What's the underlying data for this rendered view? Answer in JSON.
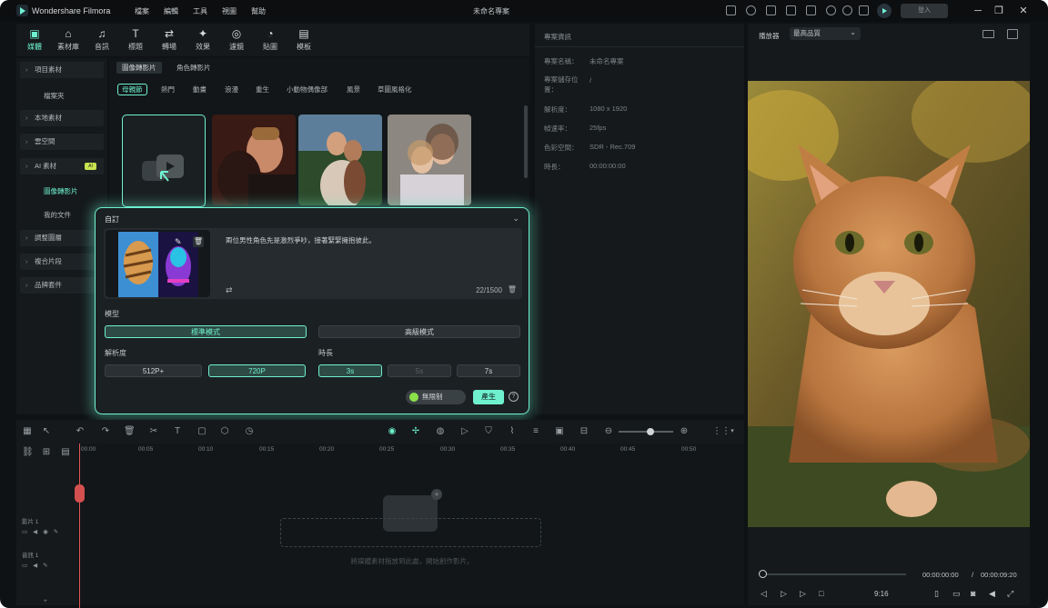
{
  "app": {
    "name": "Wondershare Filmora",
    "doc_title": "未命名專案",
    "signin_label": "登入"
  },
  "menu": [
    "檔案",
    "編輯",
    "工具",
    "視圖",
    "幫助"
  ],
  "toolbar": [
    "媒體",
    "素材庫",
    "音訊",
    "標題",
    "轉場",
    "效果",
    "濾鏡",
    "貼圖",
    "模板"
  ],
  "sidebar": {
    "items": [
      "項目素材",
      "本地素材",
      "雲空間",
      "AI 素材",
      "調整圖層",
      "複合片段",
      "品牌套件"
    ],
    "sub": [
      "檔案夾",
      "圖像轉影片",
      "我的文件"
    ],
    "ai_badge": "AI"
  },
  "media": {
    "tabs": [
      "圖像轉影片",
      "角色轉影片"
    ],
    "chips": [
      "母親節",
      "熱門",
      "動畫",
      "浪漫",
      "重生",
      "小動物偶像部",
      "風景",
      "草圖風格化"
    ]
  },
  "props": {
    "header": "專案資訊",
    "rows": [
      {
        "label": "專案名稱：",
        "value": "未命名專案"
      },
      {
        "label": "專案儲存位置：",
        "value": "/"
      },
      {
        "label": "解析度：",
        "value": "1080 x 1920"
      },
      {
        "label": "幀速率：",
        "value": "25fps"
      },
      {
        "label": "色彩空間：",
        "value": "SDR - Rec.709"
      },
      {
        "label": "時長：",
        "value": "00:00:00:00"
      }
    ]
  },
  "player": {
    "label": "播放器",
    "quality": "最高品質",
    "current": "00:00:00:00",
    "sep": "/",
    "total": "00:00:09:20",
    "ratio": "9:16"
  },
  "modal": {
    "title": "自訂",
    "prompt": "兩位男性角色先是激烈爭吵，接著緊緊擁抱彼此。",
    "counter": "22/1500",
    "model_label": "模型",
    "model_options": [
      "標準模式",
      "高級模式"
    ],
    "resolution_label": "解析度",
    "resolution_options": [
      "512P+",
      "720P"
    ],
    "duration_label": "時長",
    "duration_options": [
      "3s",
      "5s",
      "7s"
    ],
    "nolimit": "無限制",
    "generate": "產生"
  },
  "timeline": {
    "ticks": [
      "00:00",
      "00:05",
      "00:10",
      "00:15",
      "00:20",
      "00:25",
      "00:30",
      "00:35",
      "00:40",
      "00:45",
      "00:50"
    ],
    "tracks": [
      "影片 1",
      "音訊 1"
    ],
    "drop_hint": "將媒體素材拖放到此處，開始創作影片。"
  },
  "colors": {
    "accent": "#6ff1d0",
    "bg": "#0f1214",
    "panel": "#15191b"
  }
}
